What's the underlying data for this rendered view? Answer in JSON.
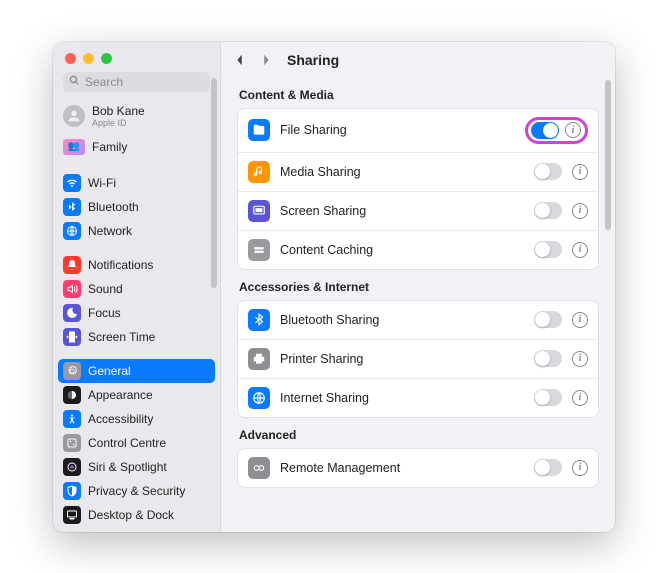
{
  "search": {
    "placeholder": "Search"
  },
  "user": {
    "name": "Bob Kane",
    "sub": "Apple ID"
  },
  "family": {
    "label": "Family"
  },
  "sidebar": {
    "items": [
      {
        "label": "Wi-Fi",
        "color": "#0a7aff"
      },
      {
        "label": "Bluetooth",
        "color": "#0a7aff"
      },
      {
        "label": "Network",
        "color": "#0a7aff"
      },
      {
        "label": "Notifications",
        "color": "#ff3b30"
      },
      {
        "label": "Sound",
        "color": "#ff3b6f"
      },
      {
        "label": "Focus",
        "color": "#5856d6"
      },
      {
        "label": "Screen Time",
        "color": "#5856d6"
      },
      {
        "label": "General",
        "color": "#9a9a9e"
      },
      {
        "label": "Appearance",
        "color": "#1c1c1e"
      },
      {
        "label": "Accessibility",
        "color": "#0a7aff"
      },
      {
        "label": "Control Centre",
        "color": "#9a9a9e"
      },
      {
        "label": "Siri & Spotlight",
        "color": "#1c1c1e"
      },
      {
        "label": "Privacy & Security",
        "color": "#0a7aff"
      },
      {
        "label": "Desktop & Dock",
        "color": "#1c1c1e"
      }
    ]
  },
  "header": {
    "title": "Sharing"
  },
  "sections": [
    {
      "title": "Content & Media",
      "rows": [
        {
          "label": "File Sharing",
          "color": "#0a7aff",
          "on": true,
          "highlight": true
        },
        {
          "label": "Media Sharing",
          "color": "#ff9500",
          "on": false
        },
        {
          "label": "Screen Sharing",
          "color": "#5856d6",
          "on": false
        },
        {
          "label": "Content Caching",
          "color": "#9a9a9e",
          "on": false
        }
      ]
    },
    {
      "title": "Accessories & Internet",
      "rows": [
        {
          "label": "Bluetooth Sharing",
          "color": "#0a7aff",
          "on": false
        },
        {
          "label": "Printer Sharing",
          "color": "#8e8e93",
          "on": false
        },
        {
          "label": "Internet Sharing",
          "color": "#0a7aff",
          "on": false
        }
      ]
    },
    {
      "title": "Advanced",
      "rows": [
        {
          "label": "Remote Management",
          "color": "#8e8e93",
          "on": false
        }
      ]
    }
  ]
}
